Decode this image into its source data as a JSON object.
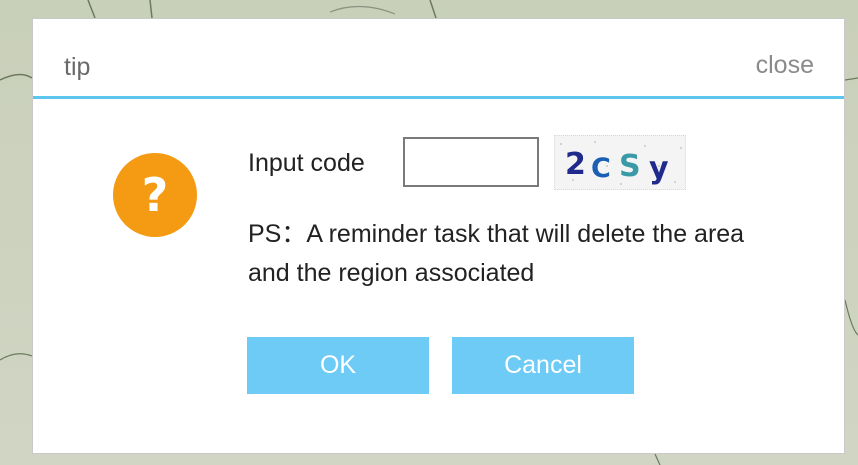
{
  "dialog": {
    "title": "tip",
    "close_label": "close"
  },
  "form": {
    "code_label": "Input code",
    "code_value": "",
    "captcha_text": "2CSy"
  },
  "message": "PS：A reminder task that will delete the area and the region associated",
  "buttons": {
    "ok_label": "OK",
    "cancel_label": "Cancel"
  },
  "colors": {
    "accent": "#5bc6ee",
    "button": "#6dcbf6",
    "warning_icon": "#f49a13"
  },
  "icons": {
    "question": "question-icon"
  }
}
